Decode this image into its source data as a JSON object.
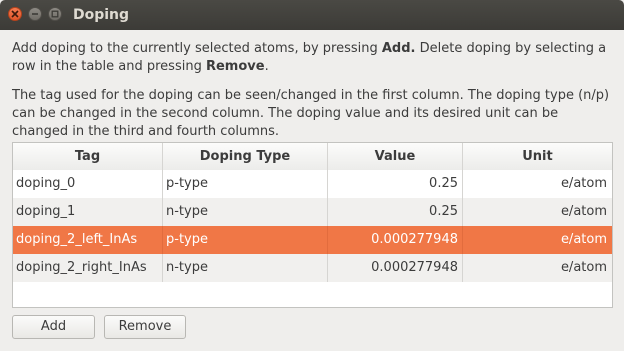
{
  "window": {
    "title": "Doping"
  },
  "instructions": {
    "p1_a": "Add doping to the currently selected atoms, by pressing ",
    "p1_add": "Add.",
    "p1_b": " Delete doping by selecting a row in the table and pressing ",
    "p1_remove": "Remove",
    "p1_c": ".",
    "p2": "The tag used for the doping can be seen/changed in the first column. The doping type (n/p) can be changed in the second column. The doping value and its desired unit can be changed in the third and fourth columns."
  },
  "table": {
    "headers": [
      "Tag",
      "Doping Type",
      "Value",
      "Unit"
    ],
    "rows": [
      {
        "tag": "doping_0",
        "type": "p-type",
        "value": "0.25",
        "unit": "e/atom"
      },
      {
        "tag": "doping_1",
        "type": "n-type",
        "value": "0.25",
        "unit": "e/atom"
      },
      {
        "tag": "doping_2_left_InAs",
        "type": "p-type",
        "value": "0.000277948",
        "unit": "e/atom"
      },
      {
        "tag": "doping_2_right_InAs",
        "type": "n-type",
        "value": "0.000277948",
        "unit": "e/atom"
      }
    ],
    "selected_row": 2
  },
  "buttons": {
    "add_label": "Add",
    "remove_label": "Remove"
  },
  "colors": {
    "selection": "#f07746",
    "close_button": "#e0562a",
    "titlebar": "#3c3b37"
  },
  "icons": {
    "close": "close-icon",
    "minimize": "minimize-icon",
    "maximize": "maximize-icon"
  }
}
